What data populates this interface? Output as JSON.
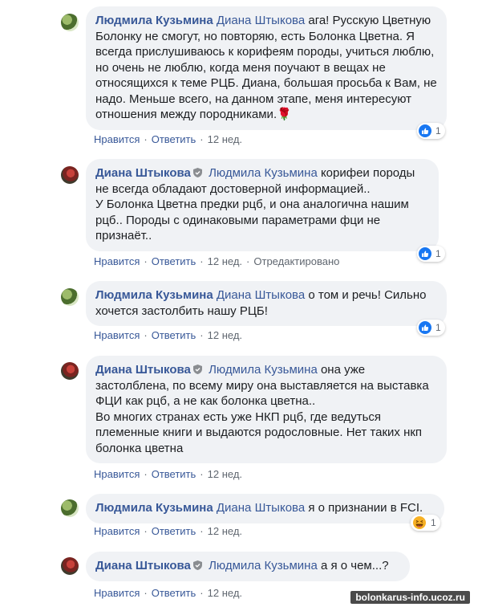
{
  "comments": [
    {
      "author": "Людмила Кузьмина",
      "avatar": "ld",
      "mention": "Диана Штыкова",
      "text": " ага! Русскую Цветную Болонку не смогут, но повторяю, есть Болонка Цветна. Я всегда прислушиваюсь к корифеям породы, учиться люблю, но очень не люблю, когда меня поучают в вещах не относящихся к теме РЦБ. Диана, большая просьба к Вам, не надо. Меньше всего, на данном этапе, меня интересуют отношения между породниками.",
      "emoji": "🌹",
      "like": "Нравится",
      "reply": "Ответить",
      "time": "12 нед.",
      "edited": "",
      "reaction": "like",
      "reaction_count": "1"
    },
    {
      "author": "Диана Штыкова",
      "avatar": "ds",
      "mention": "Людмила Кузьмина",
      "text": " корифеи породы не всегда обладают достоверной информацией..\nУ Болонка Цветна предки рцб, и она аналогична нашим рцб.. Породы с одинаковыми параметрами фци не признаёт..",
      "emoji": "",
      "like": "Нравится",
      "reply": "Ответить",
      "time": "12 нед.",
      "edited": "Отредактировано",
      "reaction": "like",
      "reaction_count": "1"
    },
    {
      "author": "Людмила Кузьмина",
      "avatar": "ld",
      "mention": "Диана Штыкова",
      "text": " о том и речь! Сильно хочется застолбить нашу РЦБ!",
      "emoji": "",
      "like": "Нравится",
      "reply": "Ответить",
      "time": "12 нед.",
      "edited": "",
      "reaction": "like",
      "reaction_count": "1"
    },
    {
      "author": "Диана Штыкова",
      "avatar": "ds",
      "mention": "Людмила Кузьмина",
      "text": " она уже застолблена, по всему миру она выставляется на выставка ФЦИ как рцб, а не как болонка цветна..\nВо многих странах есть уже НКП рцб, где ведуться племенные книги и выдаются родословные. Нет таких нкп болонка цветна",
      "emoji": "",
      "like": "Нравится",
      "reply": "Ответить",
      "time": "12 нед.",
      "edited": "",
      "reaction": "",
      "reaction_count": ""
    },
    {
      "author": "Людмила Кузьмина",
      "avatar": "ld",
      "mention": "Диана Штыкова",
      "text": " я о признании в FCI.",
      "emoji": "",
      "like": "Нравится",
      "reply": "Ответить",
      "time": "12 нед.",
      "edited": "",
      "reaction": "haha",
      "reaction_count": "1"
    },
    {
      "author": "Диана Штыкова",
      "avatar": "ds",
      "mention": "Людмила Кузьмина",
      "text": " а я о чем...?",
      "emoji": "",
      "like": "Нравится",
      "reply": "Ответить",
      "time": "12 нед.",
      "edited": "",
      "reaction": "",
      "reaction_count": ""
    }
  ],
  "watermark": "bolonkarus-info.ucoz.ru",
  "colors": {
    "link": "#385898",
    "bubble": "#f0f2f5",
    "like_blue": "#1877f2",
    "muted": "#606770"
  },
  "icons": {
    "verified": "shield-icon",
    "like": "thumbs-up-icon",
    "haha": "laughing-emoji-icon"
  }
}
